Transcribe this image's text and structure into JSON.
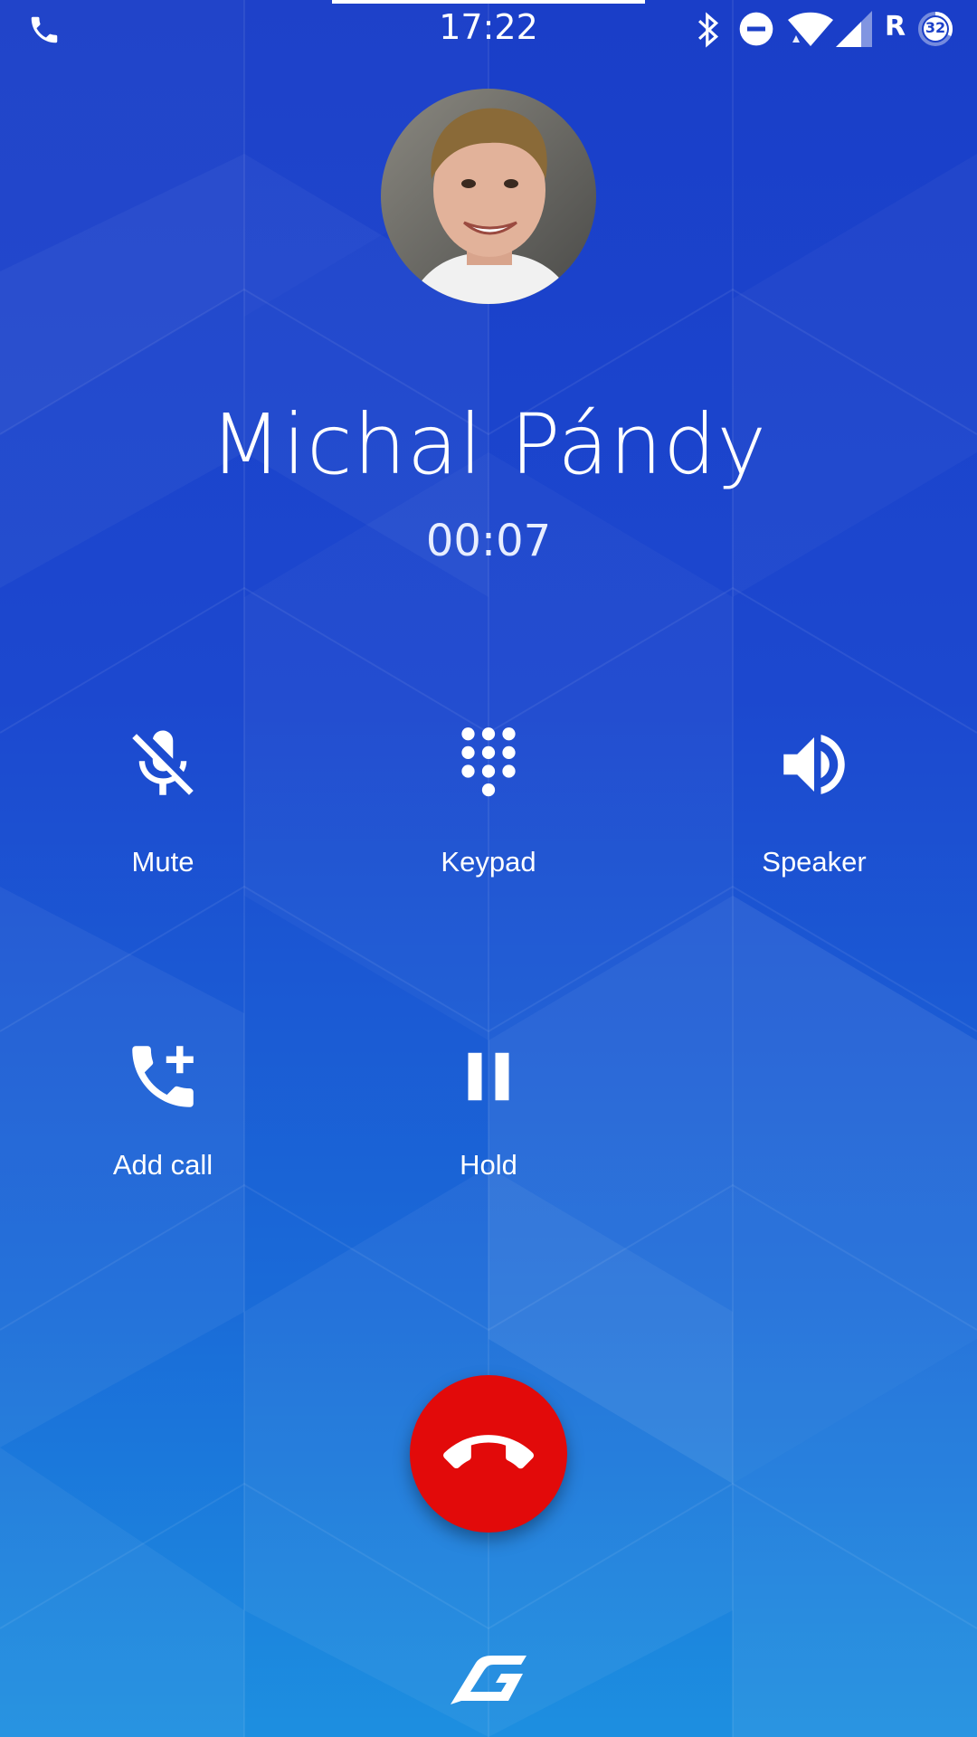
{
  "status_bar": {
    "time": "17:22",
    "roaming_indicator": "R",
    "battery_level": "32",
    "icons": [
      "phone-call-icon",
      "bluetooth-icon",
      "do-not-disturb-icon",
      "wifi-icon",
      "cell-signal-icon",
      "battery-icon"
    ]
  },
  "call": {
    "caller_name": "Michal Pándy",
    "duration": "00:07"
  },
  "controls": {
    "mute_label": "Mute",
    "keypad_label": "Keypad",
    "speaker_label": "Speaker",
    "add_call_label": "Add call",
    "hold_label": "Hold"
  },
  "colors": {
    "end_call": "#e20a0a",
    "background_top": "#1a3ec8",
    "background_bottom": "#1d8fe0"
  }
}
